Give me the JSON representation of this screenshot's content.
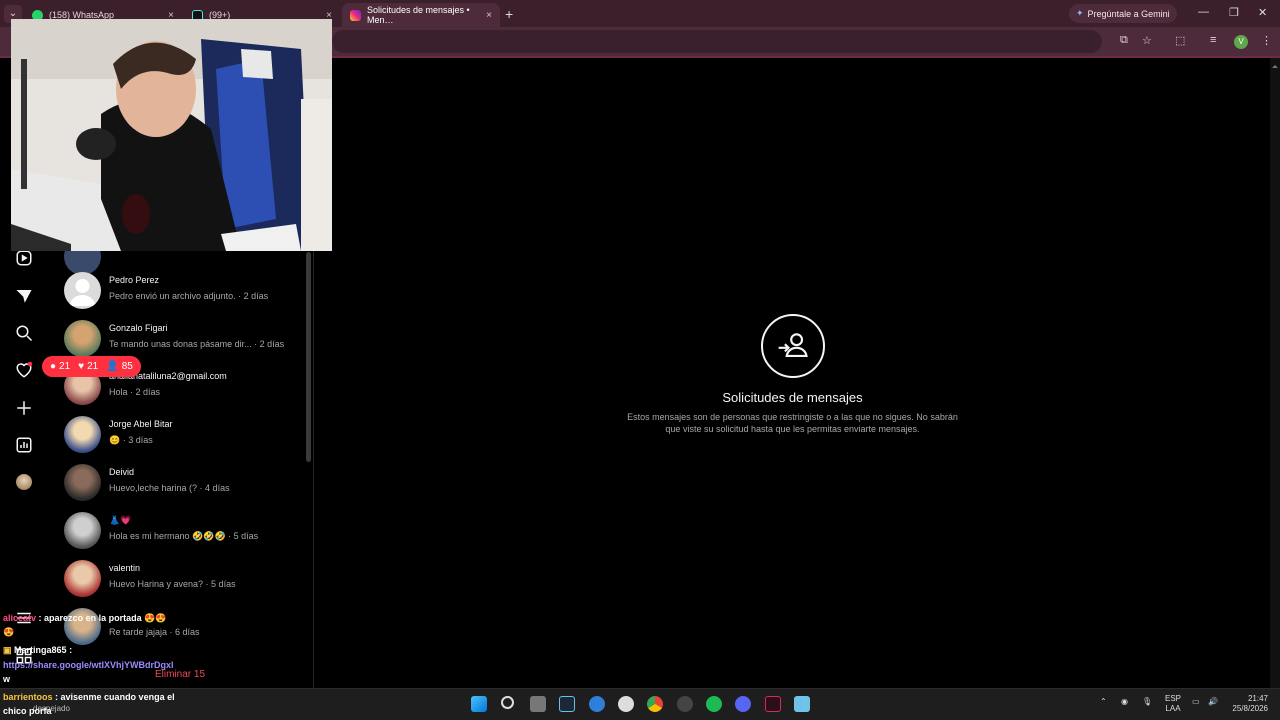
{
  "browser": {
    "tabs": [
      {
        "title": "(158) WhatsApp",
        "close": "×"
      },
      {
        "title": "(99+)",
        "close": "×"
      },
      {
        "title": "Solicitudes de mensajes • Men…",
        "close": "×"
      }
    ],
    "new_tab": "+",
    "gemini_button": "Pregúntale a Gemini",
    "profile_initial": "V",
    "colors": {
      "frame": "#3b1f2b",
      "toolbar": "#4e2b3b"
    }
  },
  "conversations": [
    {
      "name": "Pedro Perez",
      "preview": "Pedro envió un archivo adjunto. · 2 días",
      "avatar": "default-avatar"
    },
    {
      "name": "Gonzalo Figari",
      "preview": "Te mando unas donas pásame dir...  · 2 días",
      "avatar": "photo-avatar"
    },
    {
      "name": "analianataliluna2@gmail.com",
      "preview": "Hola · 2 días",
      "avatar": "photo-avatar"
    },
    {
      "name": "Jorge Abel Bitar",
      "preview": "😊 · 3 días",
      "avatar": "photo-avatar"
    },
    {
      "name": "Deivid",
      "preview": "Huevo,leche harina (? · 4 días",
      "avatar": "photo-avatar"
    },
    {
      "name": "👗💗",
      "preview": "Hola es mi hermano 🤣🤣🤣 · 5 días",
      "avatar": "photo-avatar"
    },
    {
      "name": "valentin",
      "preview": "Huevo Harina y avena? · 5 días",
      "avatar": "photo-avatar"
    },
    {
      "name": "",
      "preview": "Re tarde jajaja · 6 días",
      "avatar": "photo-avatar"
    }
  ],
  "notifications": {
    "comments": "21",
    "likes": "21",
    "followers": "85"
  },
  "empty_state": {
    "title": "Solicitudes de mensajes",
    "description": "Estos mensajes son de personas que restringiste o a las que no sigues. No sabrán que viste su solicitud hasta que les permitas enviarte mensajes."
  },
  "delete_action": "Eliminar 15",
  "stream_chat": [
    {
      "user": "aliceatv",
      "message": ": aparezco en la portada 😍😍",
      "extra": "😍",
      "user_color": "#ff4f8b"
    },
    {
      "user": "Martinga865",
      "message": ":",
      "link": "https://share.google/wtIXVhjYWBdrDgxl",
      "extra": "w",
      "user_color": "#ffffff"
    },
    {
      "user": "barrientoos",
      "message": ": avisenme cuando venga el chico porfa",
      "user_color": "#f5c542"
    }
  ],
  "taskbar": {
    "weather": "despejado",
    "language": "ESP",
    "layout": "LAA",
    "time": "21:47",
    "date": "25/8/2026"
  }
}
